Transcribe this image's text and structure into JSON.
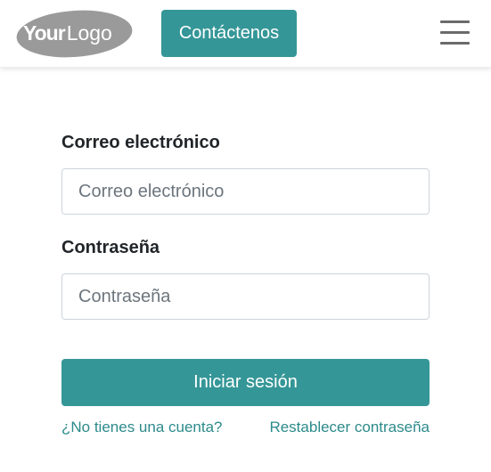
{
  "header": {
    "logo_text_bold": "Your",
    "logo_text_light": "Logo",
    "contact_label": "Contáctenos",
    "menu_icon": "hamburger-menu-icon"
  },
  "form": {
    "email_label": "Correo electrónico",
    "email_placeholder": "Correo electrónico",
    "email_value": "",
    "password_label": "Contraseña",
    "password_placeholder": "Contraseña",
    "password_value": "",
    "submit_label": "Iniciar sesión",
    "signup_link": "¿No tienes una cuenta?",
    "reset_link": "Restablecer contraseña"
  },
  "colors": {
    "accent": "#359697",
    "link": "#2d8a8b",
    "logo_gray": "#9a9a9a",
    "menu_gray": "#6b6b6b"
  }
}
